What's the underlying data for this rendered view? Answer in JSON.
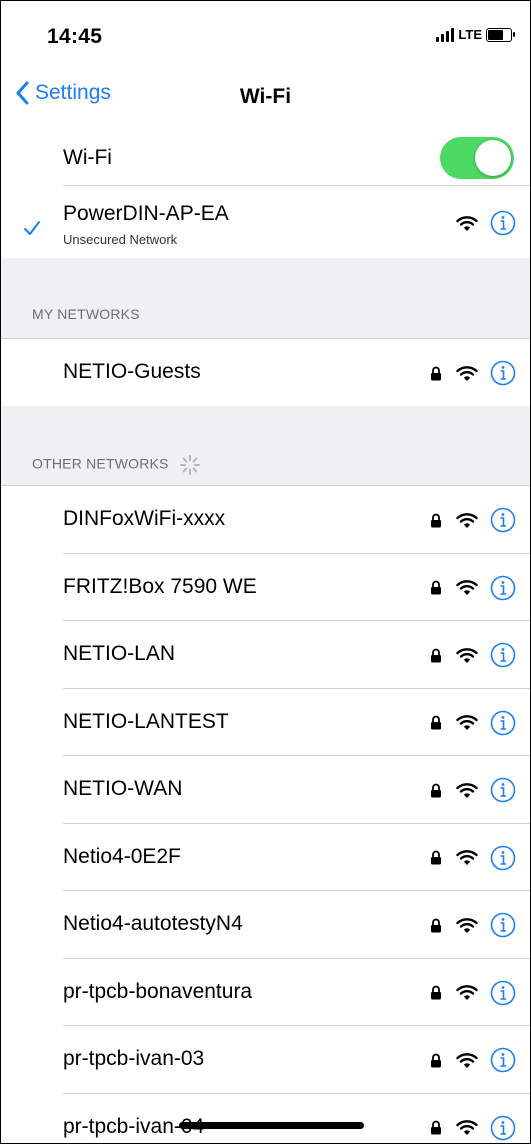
{
  "status_bar": {
    "time": "14:45",
    "network_type": "LTE"
  },
  "nav": {
    "back_label": "Settings",
    "title": "Wi-Fi"
  },
  "wifi_toggle": {
    "label": "Wi-Fi",
    "enabled": true
  },
  "connected": {
    "name": "PowerDIN-AP-EA",
    "subtitle": "Unsecured Network",
    "icons": [
      "checkmark-icon",
      "wifi-icon",
      "info-icon"
    ]
  },
  "my_networks": {
    "header": "MY NETWORKS",
    "items": [
      {
        "name": "NETIO-Guests",
        "locked": true
      }
    ]
  },
  "other_networks": {
    "header": "OTHER NETWORKS",
    "items": [
      {
        "name": "DINFoxWiFi-xxxx",
        "locked": true
      },
      {
        "name": "FRITZ!Box 7590 WE",
        "locked": true
      },
      {
        "name": "NETIO-LAN",
        "locked": true
      },
      {
        "name": "NETIO-LANTEST",
        "locked": true
      },
      {
        "name": "NETIO-WAN",
        "locked": true
      },
      {
        "name": "Netio4-0E2F",
        "locked": true
      },
      {
        "name": "Netio4-autotestyN4",
        "locked": true
      },
      {
        "name": "pr-tpcb-bonaventura",
        "locked": true
      },
      {
        "name": "pr-tpcb-ivan-03",
        "locked": true
      },
      {
        "name": "pr-tpcb-ivan-04",
        "locked": true
      }
    ]
  },
  "colors": {
    "accent": "#1a7ef7",
    "toggle_on": "#4cd964",
    "group_background": "#efeff4"
  }
}
